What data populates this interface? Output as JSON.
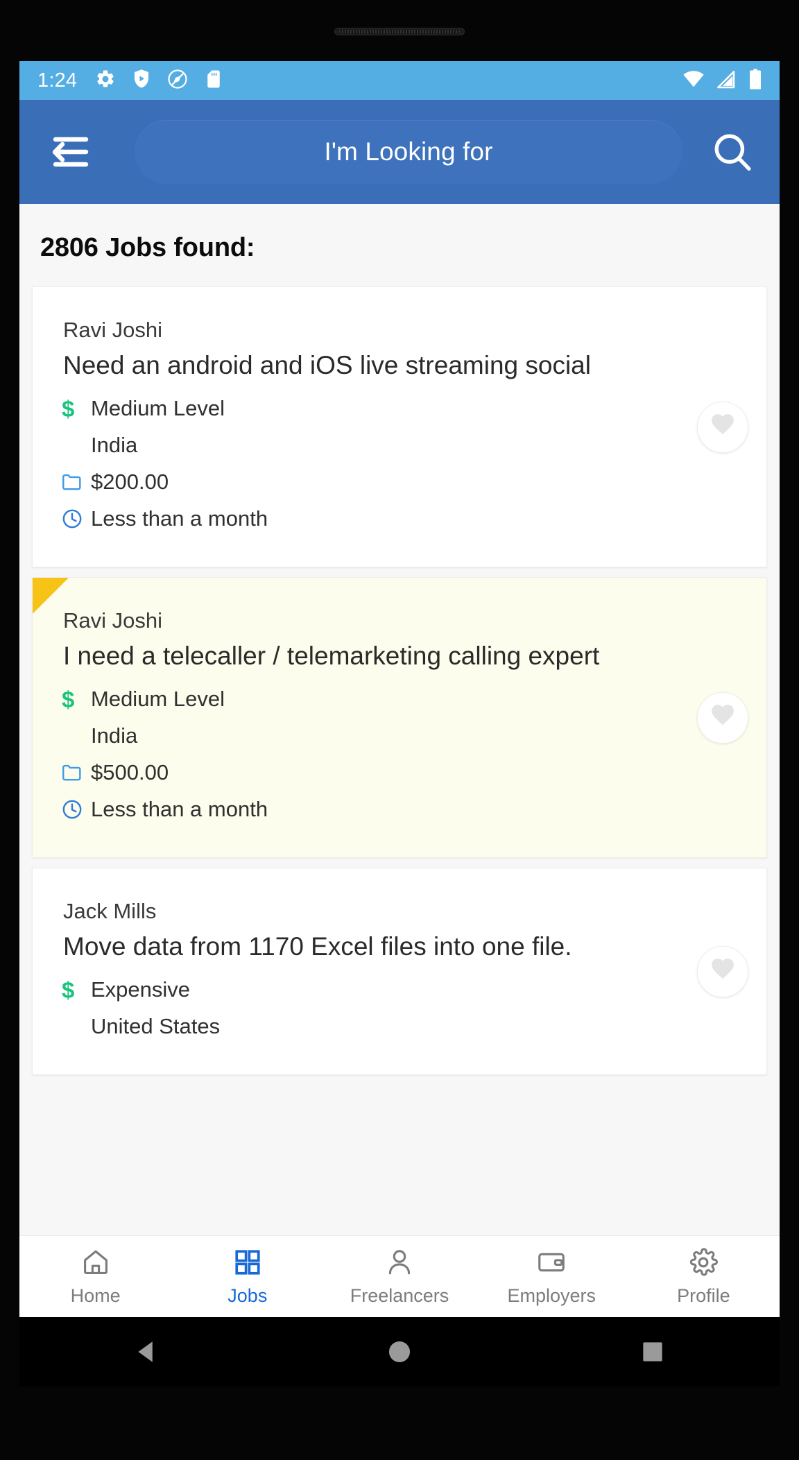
{
  "status_bar": {
    "time": "1:24",
    "left_icons": [
      "gear-icon",
      "play-protect-shield-icon",
      "location-off-icon",
      "sd-card-icon"
    ],
    "right_icons": [
      "wifi-icon",
      "cellular-signal-icon",
      "battery-icon"
    ],
    "background_color": "#54ADE3"
  },
  "app_bar": {
    "menu_icon": "menu-back-icon",
    "search_placeholder": "I'm Looking for",
    "search_icon": "search-icon",
    "background_color": "#3A6FB8"
  },
  "main": {
    "results_title": "2806 Jobs found:",
    "jobs": [
      {
        "poster": "Ravi Joshi",
        "title": "Need an android and iOS live streaming social",
        "level": "Medium Level",
        "country": "India",
        "budget": "$200.00",
        "duration": "Less than a month",
        "highlighted": false,
        "favorite_icon": "heart-icon"
      },
      {
        "poster": "Ravi Joshi",
        "title": "I need a telecaller / telemarketing calling expert",
        "level": "Medium Level",
        "country": "India",
        "budget": "$500.00",
        "duration": "Less than a month",
        "highlighted": true,
        "favorite_icon": "heart-icon"
      },
      {
        "poster": "Jack Mills",
        "title": "Move data from 1170 Excel files into one file.",
        "level": "Expensive",
        "country": "United States",
        "budget": "",
        "duration": "",
        "highlighted": false,
        "favorite_icon": "heart-icon"
      }
    ],
    "icons": {
      "level": "dollar-icon",
      "country": "location-icon",
      "budget": "folder-icon",
      "duration": "clock-icon"
    },
    "colors": {
      "dollar": "#1BC47D",
      "folder": "#3D9BE9",
      "clock": "#2C7DD4",
      "ribbon": "#F6C316",
      "highlight_background": "#FDFDEE"
    }
  },
  "bottom_nav": {
    "active_index": 1,
    "active_color": "#1769D6",
    "inactive_color": "#7C7C7C",
    "items": [
      {
        "label": "Home",
        "icon": "home-icon"
      },
      {
        "label": "Jobs",
        "icon": "grid-icon"
      },
      {
        "label": "Freelancers",
        "icon": "person-icon"
      },
      {
        "label": "Employers",
        "icon": "card-icon"
      },
      {
        "label": "Profile",
        "icon": "gear-icon"
      }
    ]
  },
  "android_nav": {
    "buttons": [
      {
        "name": "back",
        "icon": "triangle-back-icon"
      },
      {
        "name": "home",
        "icon": "circle-home-icon"
      },
      {
        "name": "recents",
        "icon": "square-recents-icon"
      }
    ]
  }
}
